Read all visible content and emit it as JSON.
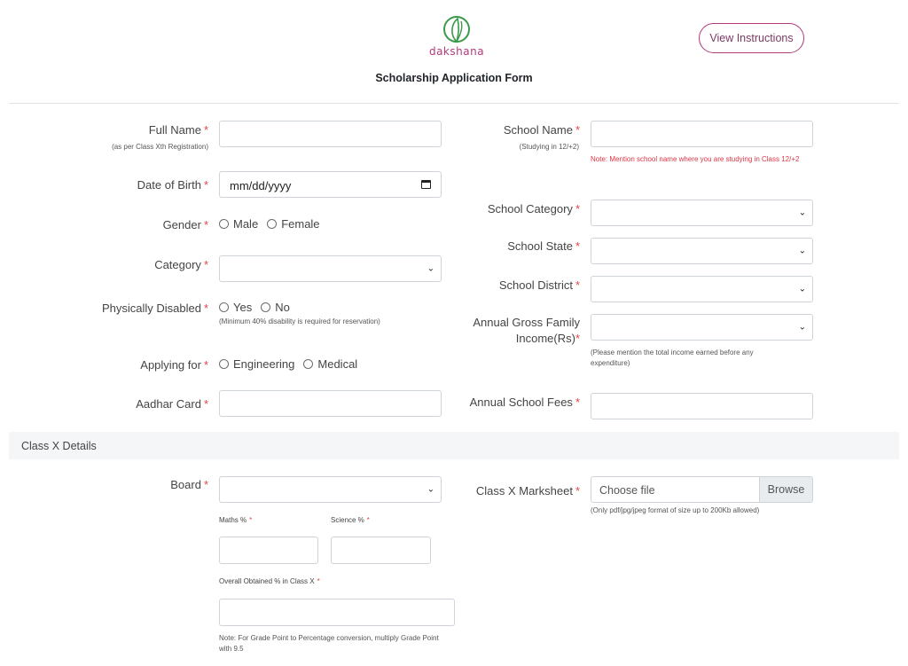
{
  "header": {
    "logo_text": "dakshana",
    "title": "Scholarship Application Form",
    "view_instructions": "View Instructions"
  },
  "required_mark": "*",
  "left": {
    "full_name": {
      "label": "Full Name",
      "sub": "(as per Class Xth Registration)"
    },
    "dob": {
      "label": "Date of Birth",
      "value": "mm/dd/yyyy"
    },
    "gender": {
      "label": "Gender",
      "options": [
        "Male",
        "Female"
      ]
    },
    "category": {
      "label": "Category"
    },
    "physically_disabled": {
      "label": "Physically Disabled",
      "options": [
        "Yes",
        "No"
      ],
      "note": "(Minimum 40% disability is required for reservation)"
    },
    "applying_for": {
      "label": "Applying for",
      "options": [
        "Engineering",
        "Medical"
      ]
    },
    "aadhar": {
      "label": "Aadhar Card"
    }
  },
  "right": {
    "school_name": {
      "label": "School Name",
      "sub": "(Studying in 12/+2)",
      "note": "Note: Mention school name where you are studying in Class 12/+2"
    },
    "school_category": {
      "label": "School Category"
    },
    "school_state": {
      "label": "School State"
    },
    "school_district": {
      "label": "School District"
    },
    "annual_income": {
      "label_line1": "Annual Gross Family",
      "label_line2": "Income(Rs)",
      "note": "(Please mention the total income earned before any expenditure)"
    },
    "annual_fees": {
      "label": "Annual School Fees"
    }
  },
  "class_x": {
    "section_title": "Class X Details",
    "board": {
      "label": "Board"
    },
    "maths": {
      "label": "Maths %"
    },
    "science": {
      "label": "Science %"
    },
    "overall": {
      "label": "Overall Obtained % in Class X",
      "note": "Note: For Grade Point to Percentage conversion, multiply Grade Point with 9.5"
    },
    "marksheet": {
      "label": "Class X Marksheet",
      "placeholder": "Choose file",
      "browse": "Browse",
      "note": "(Only pdf/jpg/jpeg format of size up to 200Kb allowed)"
    }
  },
  "colors": {
    "brand": "#b4397a",
    "required": "#e04848",
    "note_red": "#dc3545",
    "border": "#ced4da"
  }
}
